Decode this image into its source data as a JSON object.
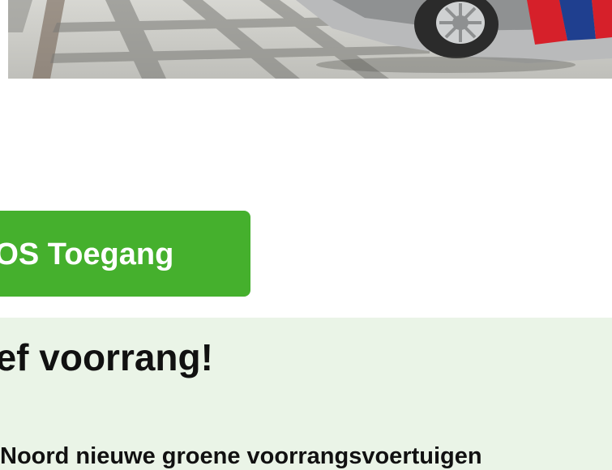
{
  "hero": {
    "image": "garage-floor-with-vehicle-photo"
  },
  "cta": {
    "label": "SOS Toegang",
    "color": "#45b02d"
  },
  "section": {
    "heading": "eef voorrang!",
    "lead": "Noord nieuwe groene voorrangsvoertuigen",
    "background": "#eaf4e7"
  }
}
